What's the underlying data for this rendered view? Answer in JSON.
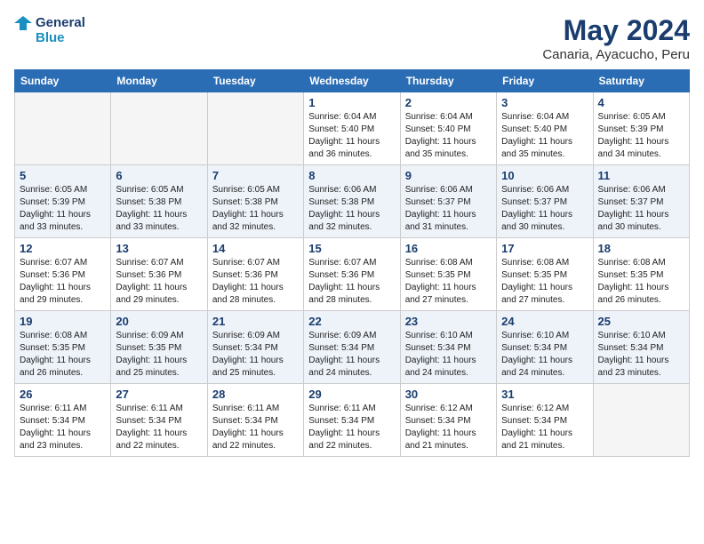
{
  "header": {
    "logo_line1": "General",
    "logo_line2": "Blue",
    "month": "May 2024",
    "location": "Canaria, Ayacucho, Peru"
  },
  "weekdays": [
    "Sunday",
    "Monday",
    "Tuesday",
    "Wednesday",
    "Thursday",
    "Friday",
    "Saturday"
  ],
  "weeks": [
    [
      {
        "day": "",
        "info": ""
      },
      {
        "day": "",
        "info": ""
      },
      {
        "day": "",
        "info": ""
      },
      {
        "day": "1",
        "info": "Sunrise: 6:04 AM\nSunset: 5:40 PM\nDaylight: 11 hours\nand 36 minutes."
      },
      {
        "day": "2",
        "info": "Sunrise: 6:04 AM\nSunset: 5:40 PM\nDaylight: 11 hours\nand 35 minutes."
      },
      {
        "day": "3",
        "info": "Sunrise: 6:04 AM\nSunset: 5:40 PM\nDaylight: 11 hours\nand 35 minutes."
      },
      {
        "day": "4",
        "info": "Sunrise: 6:05 AM\nSunset: 5:39 PM\nDaylight: 11 hours\nand 34 minutes."
      }
    ],
    [
      {
        "day": "5",
        "info": "Sunrise: 6:05 AM\nSunset: 5:39 PM\nDaylight: 11 hours\nand 33 minutes."
      },
      {
        "day": "6",
        "info": "Sunrise: 6:05 AM\nSunset: 5:38 PM\nDaylight: 11 hours\nand 33 minutes."
      },
      {
        "day": "7",
        "info": "Sunrise: 6:05 AM\nSunset: 5:38 PM\nDaylight: 11 hours\nand 32 minutes."
      },
      {
        "day": "8",
        "info": "Sunrise: 6:06 AM\nSunset: 5:38 PM\nDaylight: 11 hours\nand 32 minutes."
      },
      {
        "day": "9",
        "info": "Sunrise: 6:06 AM\nSunset: 5:37 PM\nDaylight: 11 hours\nand 31 minutes."
      },
      {
        "day": "10",
        "info": "Sunrise: 6:06 AM\nSunset: 5:37 PM\nDaylight: 11 hours\nand 30 minutes."
      },
      {
        "day": "11",
        "info": "Sunrise: 6:06 AM\nSunset: 5:37 PM\nDaylight: 11 hours\nand 30 minutes."
      }
    ],
    [
      {
        "day": "12",
        "info": "Sunrise: 6:07 AM\nSunset: 5:36 PM\nDaylight: 11 hours\nand 29 minutes."
      },
      {
        "day": "13",
        "info": "Sunrise: 6:07 AM\nSunset: 5:36 PM\nDaylight: 11 hours\nand 29 minutes."
      },
      {
        "day": "14",
        "info": "Sunrise: 6:07 AM\nSunset: 5:36 PM\nDaylight: 11 hours\nand 28 minutes."
      },
      {
        "day": "15",
        "info": "Sunrise: 6:07 AM\nSunset: 5:36 PM\nDaylight: 11 hours\nand 28 minutes."
      },
      {
        "day": "16",
        "info": "Sunrise: 6:08 AM\nSunset: 5:35 PM\nDaylight: 11 hours\nand 27 minutes."
      },
      {
        "day": "17",
        "info": "Sunrise: 6:08 AM\nSunset: 5:35 PM\nDaylight: 11 hours\nand 27 minutes."
      },
      {
        "day": "18",
        "info": "Sunrise: 6:08 AM\nSunset: 5:35 PM\nDaylight: 11 hours\nand 26 minutes."
      }
    ],
    [
      {
        "day": "19",
        "info": "Sunrise: 6:08 AM\nSunset: 5:35 PM\nDaylight: 11 hours\nand 26 minutes."
      },
      {
        "day": "20",
        "info": "Sunrise: 6:09 AM\nSunset: 5:35 PM\nDaylight: 11 hours\nand 25 minutes."
      },
      {
        "day": "21",
        "info": "Sunrise: 6:09 AM\nSunset: 5:34 PM\nDaylight: 11 hours\nand 25 minutes."
      },
      {
        "day": "22",
        "info": "Sunrise: 6:09 AM\nSunset: 5:34 PM\nDaylight: 11 hours\nand 24 minutes."
      },
      {
        "day": "23",
        "info": "Sunrise: 6:10 AM\nSunset: 5:34 PM\nDaylight: 11 hours\nand 24 minutes."
      },
      {
        "day": "24",
        "info": "Sunrise: 6:10 AM\nSunset: 5:34 PM\nDaylight: 11 hours\nand 24 minutes."
      },
      {
        "day": "25",
        "info": "Sunrise: 6:10 AM\nSunset: 5:34 PM\nDaylight: 11 hours\nand 23 minutes."
      }
    ],
    [
      {
        "day": "26",
        "info": "Sunrise: 6:11 AM\nSunset: 5:34 PM\nDaylight: 11 hours\nand 23 minutes."
      },
      {
        "day": "27",
        "info": "Sunrise: 6:11 AM\nSunset: 5:34 PM\nDaylight: 11 hours\nand 22 minutes."
      },
      {
        "day": "28",
        "info": "Sunrise: 6:11 AM\nSunset: 5:34 PM\nDaylight: 11 hours\nand 22 minutes."
      },
      {
        "day": "29",
        "info": "Sunrise: 6:11 AM\nSunset: 5:34 PM\nDaylight: 11 hours\nand 22 minutes."
      },
      {
        "day": "30",
        "info": "Sunrise: 6:12 AM\nSunset: 5:34 PM\nDaylight: 11 hours\nand 21 minutes."
      },
      {
        "day": "31",
        "info": "Sunrise: 6:12 AM\nSunset: 5:34 PM\nDaylight: 11 hours\nand 21 minutes."
      },
      {
        "day": "",
        "info": ""
      }
    ]
  ]
}
